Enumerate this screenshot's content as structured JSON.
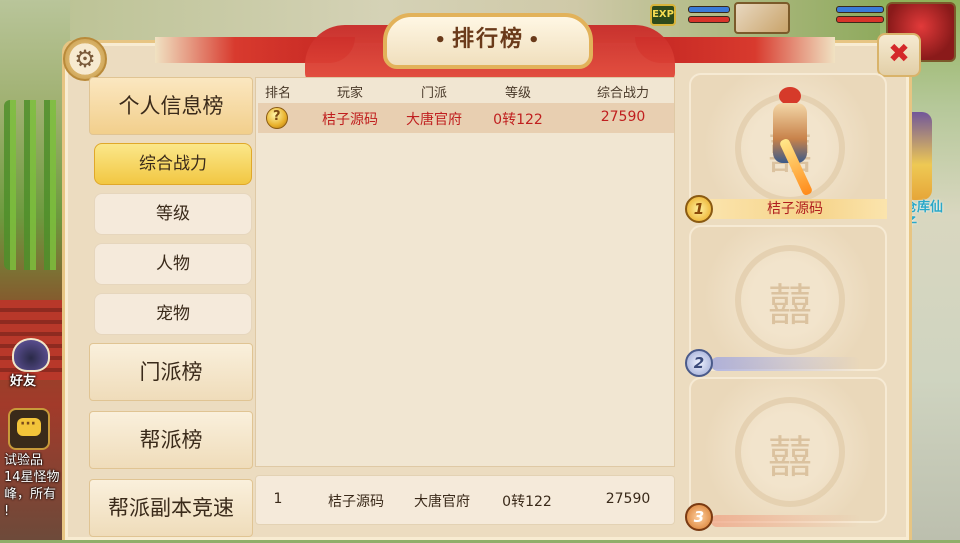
{
  "hud": {
    "exp_label": "EXP"
  },
  "colors": {
    "accent_red": "#c01f1f",
    "panel_bg": "#ecdcc0",
    "gold": "#f2c742"
  },
  "panel": {
    "title": "排行榜",
    "settings_icon": "gear-icon",
    "close_icon": "close-icon"
  },
  "nav": {
    "categories": [
      {
        "label": "个人信息榜",
        "active": true
      },
      {
        "label": "门派榜"
      },
      {
        "label": "帮派榜"
      },
      {
        "label": "帮派副本竞速"
      }
    ],
    "subs": [
      {
        "label": "综合战力",
        "active": true
      },
      {
        "label": "等级"
      },
      {
        "label": "人物"
      },
      {
        "label": "宠物"
      }
    ]
  },
  "table": {
    "headers": [
      "排名",
      "玩家",
      "门派",
      "等级",
      "综合战力"
    ],
    "rows": [
      {
        "rank_icon": "medal-icon",
        "player": "桔子源码",
        "sect": "大唐官府",
        "level": "0转122",
        "power": "27590"
      }
    ],
    "mine": {
      "rank": "1",
      "player": "桔子源码",
      "sect": "大唐官府",
      "level": "0转122",
      "power": "27590"
    }
  },
  "podium": [
    {
      "rank": "1",
      "name": "桔子源码"
    },
    {
      "rank": "2",
      "name": ""
    },
    {
      "rank": "3",
      "name": ""
    }
  ],
  "side": {
    "friend_label": "好友",
    "chat_lines": [
      "试验品",
      "14星怪物",
      "峰，所有",
      "!"
    ],
    "npc_label": "仓库仙子"
  }
}
